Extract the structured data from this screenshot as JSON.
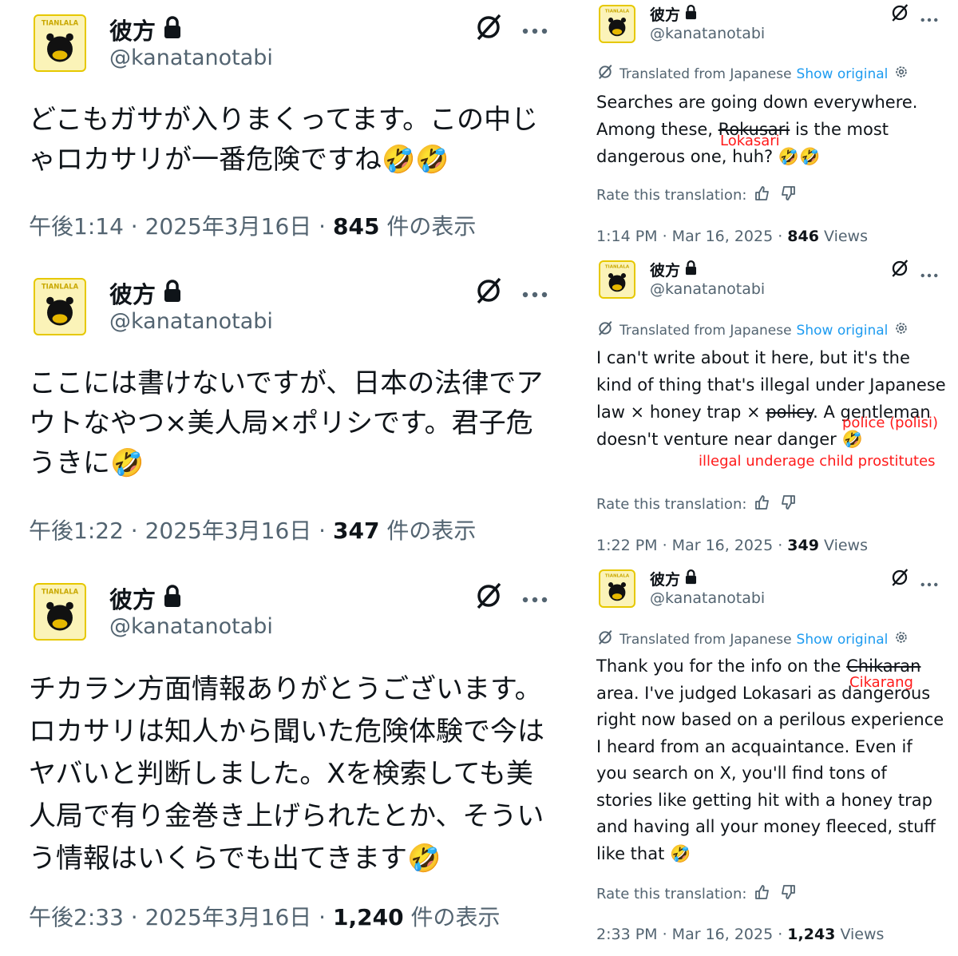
{
  "left": [
    {
      "name": "彼方",
      "handle": "@kanatanotabi",
      "text": "どこもガサが入りまくってます。この中じゃロカサリが一番危険ですね🤣🤣",
      "time": "午後1:14 · 2025年3月16日 · ",
      "views": "845",
      "views_label": " 件の表示"
    },
    {
      "name": "彼方",
      "handle": "@kanatanotabi",
      "text": "ここには書けないですが、日本の法律でアウトなやつ×美人局×ポリシです。君子危うきに🤣",
      "time": "午後1:22 · 2025年3月16日 · ",
      "views": "347",
      "views_label": " 件の表示"
    },
    {
      "name": "彼方",
      "handle": "@kanatanotabi",
      "text": "チカラン方面情報ありがとうございます。ロカサリは知人から聞いた危険体験で今はヤバいと判断しました。Xを検索しても美人局で有り金巻き上げられたとか、そういう情報はいくらでも出てきます🤣",
      "time": "午後2:33 · 2025年3月16日 · ",
      "views": "1,240",
      "views_label": " 件の表示"
    }
  ],
  "right": [
    {
      "name": "彼方",
      "handle": "@kanatanotabi",
      "translated": "Translated from Japanese",
      "show_original": "Show original",
      "text_a": "Searches are going down everywhere. Among these, ",
      "strike": "Rokusari",
      "text_b": " is the most dangerous one, huh? 🤣🤣",
      "annot": "Lokasari",
      "rate": "Rate this translation:",
      "time": "1:14 PM · Mar 16, 2025 · ",
      "views": "846",
      "views_label": " Views"
    },
    {
      "name": "彼方",
      "handle": "@kanatanotabi",
      "translated": "Translated from Japanese",
      "show_original": "Show original",
      "text_a": "I can't write about it here, but it's the kind of thing that's illegal under Japanese law × honey trap × ",
      "strike": "policy",
      "text_b": ". A gentleman doesn't venture near danger 🤣",
      "annot": "police (polisi)",
      "annot2": "illegal underage child prostitutes",
      "rate": "Rate this translation:",
      "time": "1:22 PM · Mar 16, 2025 · ",
      "views": "349",
      "views_label": " Views"
    },
    {
      "name": "彼方",
      "handle": "@kanatanotabi",
      "translated": "Translated from Japanese",
      "show_original": "Show original",
      "text_a": "Thank you for the info on the ",
      "strike": "Chikaran",
      "text_b": " area. I've judged Lokasari as dangerous right now based on a perilous experience I heard from an acquaintance. Even if you search on X, you'll find tons of stories like getting hit with a honey trap and having all your money fleeced, stuff like that 🤣",
      "annot": "Cikarang",
      "rate": "Rate this translation:",
      "time": "2:33 PM · Mar 16, 2025 · ",
      "views": "1,243",
      "views_label": " Views"
    }
  ],
  "icons": {
    "lock": "lock-icon",
    "grok": "grok-icon",
    "more": "more-icon",
    "translate": "translate-icon",
    "gear": "gear-icon",
    "thumb_up": "thumbs-up-icon",
    "thumb_down": "thumbs-down-icon"
  },
  "colors": {
    "text": "#0f1419",
    "secondary": "#536471",
    "link": "#1d9bf0",
    "annotation": "#ff1a1a",
    "avatar_bg": "#fbf3b8"
  }
}
